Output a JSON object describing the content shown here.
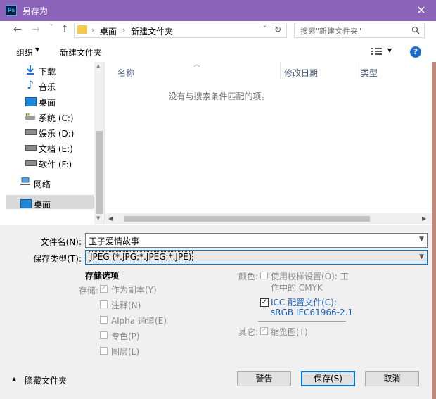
{
  "window": {
    "title": "另存为",
    "app_icon": "photoshop-icon"
  },
  "nav": {
    "back": "←",
    "forward": "→",
    "recent": "˅",
    "up": "↑",
    "breadcrumb": [
      "桌面",
      "新建文件夹"
    ],
    "sep": "›",
    "refresh": "↻",
    "search_placeholder": "搜索\"新建文件夹\""
  },
  "toolbar": {
    "organize": "组织",
    "new_folder": "新建文件夹"
  },
  "sidebar": {
    "items": [
      {
        "label": "下载",
        "icon": "download-icon"
      },
      {
        "label": "音乐",
        "icon": "music-icon"
      },
      {
        "label": "桌面",
        "icon": "desktop-icon"
      },
      {
        "label": "系统 (C:)",
        "icon": "drive-icon"
      },
      {
        "label": "娱乐 (D:)",
        "icon": "drive-icon"
      },
      {
        "label": "文档 (E:)",
        "icon": "drive-icon"
      },
      {
        "label": "软件 (F:)",
        "icon": "drive-icon"
      },
      {
        "label": "网络",
        "icon": "network-icon"
      },
      {
        "label": "桌面",
        "icon": "desktop-icon"
      }
    ]
  },
  "filelist": {
    "columns": [
      "名称",
      "修改日期",
      "类型"
    ],
    "empty": "没有与搜索条件匹配的项。"
  },
  "form": {
    "filename_label": "文件名(N):",
    "filename_value": "玉子爱情故事",
    "type_label": "保存类型(T):",
    "type_value": "JPEG (*.JPG;*.JPEG;*.JPE)"
  },
  "options": {
    "heading": "存储选项",
    "store_label": "存储:",
    "as_copy": "作为副本(Y)",
    "notes": "注释(N)",
    "alpha": "Alpha 通道(E)",
    "spot": "专色(P)",
    "layers": "图层(L)",
    "color_label": "颜色:",
    "use_proof_1": "使用校样设置(O):  工",
    "use_proof_2": "作中的 CMYK",
    "icc_1": "ICC 配置文件(C):",
    "icc_2": "sRGB IEC61966-2.1",
    "other_label": "其它:",
    "thumbnail": "缩览图(T)"
  },
  "footer": {
    "hide_folders": "隐藏文件夹",
    "warning": "警告",
    "save": "保存(S)",
    "cancel": "取消"
  },
  "colors": {
    "titlebar": "#8b64b9",
    "icc_text": "#1a5fb4",
    "primary_border": "#0078d7"
  }
}
